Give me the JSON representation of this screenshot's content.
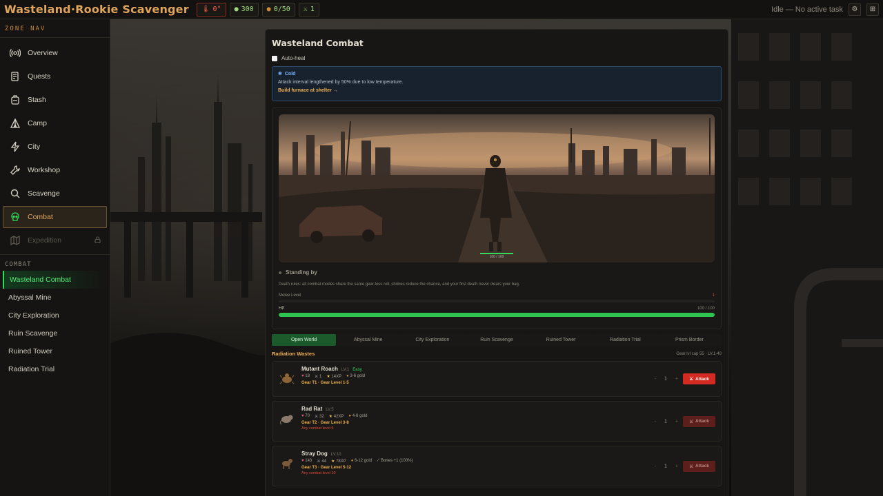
{
  "header": {
    "title": "Wasteland·Rookie Scavenger",
    "chips": [
      {
        "icon": "thermometer-icon",
        "value": "0°",
        "color": "#ff5a48"
      },
      {
        "icon": "coin-icon",
        "value": "300",
        "color": "#9fdc7f"
      },
      {
        "icon": "bag-icon",
        "value": "0/50",
        "color": "#9fdc7f"
      },
      {
        "icon": "swords-icon",
        "value": "1",
        "color": "#9fdc7f"
      }
    ],
    "status": "Idle — No active task",
    "settings_icon": "gear-icon",
    "panel_icon": "layout-icon"
  },
  "sidebar": {
    "heading": "ZONE NAV",
    "items": [
      {
        "label": "Overview",
        "icon": "radio-icon"
      },
      {
        "label": "Quests",
        "icon": "scroll-icon"
      },
      {
        "label": "Stash",
        "icon": "backpack-icon"
      },
      {
        "label": "Camp",
        "icon": "tent-icon"
      },
      {
        "label": "City",
        "icon": "bolt-icon"
      },
      {
        "label": "Workshop",
        "icon": "wrench-icon"
      },
      {
        "label": "Scavenge",
        "icon": "search-icon"
      },
      {
        "label": "Combat",
        "icon": "skull-icon"
      },
      {
        "label": "Expedition",
        "icon": "map-icon"
      }
    ],
    "sub_heading": "COMBAT",
    "sub_items": [
      "Wasteland Combat",
      "Abyssal Mine",
      "City Exploration",
      "Ruin Scavenge",
      "Ruined Tower",
      "Radiation Trial"
    ]
  },
  "main": {
    "title": "Wasteland Combat",
    "autoheal_label": "Auto-heal",
    "notice": {
      "title": "Cold",
      "body": "Attack interval lengthened by 50% due to low temperature.",
      "link": "Build furnace at shelter →"
    },
    "scene_hp": "100 / 100",
    "status": "Standing by",
    "rules": "Death rules: all combat modes share the same gear-loss roll, shrines reduce the chance, and your first death never clears your bag.",
    "melee_label": "Melee Level",
    "melee_value": "1",
    "hp_label": "HP",
    "hp_value": "100 / 100",
    "hp_fraction": 1.0,
    "tabs": [
      "Open World",
      "Abyssal Mine",
      "City Exploration",
      "Ruin Scavenge",
      "Ruined Tower",
      "Radiation Trial",
      "Prism Border"
    ],
    "zone_title": "Radiation Wastes",
    "zone_meta": "Gear lvl cap 55 · LV.1-40",
    "enemies": [
      {
        "name": "Mutant Roach",
        "level": "LV.1",
        "difficulty": "Easy",
        "hp": "18",
        "atk": "1",
        "xp": "14XP",
        "gold": "3-6 gold",
        "extra": "",
        "gear": "Gear T1 · Gear Level 1-5",
        "requirement": "",
        "qty": "1",
        "attack_label": "Attack"
      },
      {
        "name": "Rad Rat",
        "level": "LV.5",
        "difficulty": "",
        "hp": "70",
        "atk": "32",
        "xp": "42XP",
        "gold": "4-8 gold",
        "extra": "",
        "gear": "Gear T2 · Gear Level 3-8",
        "requirement": "Any combat level 5",
        "qty": "1",
        "attack_label": "Attack"
      },
      {
        "name": "Stray Dog",
        "level": "LV.10",
        "difficulty": "",
        "hp": "143",
        "atk": "44",
        "xp": "78XP",
        "gold": "6-12 gold",
        "extra": "Bones +1 (100%)",
        "gear": "Gear T3 · Gear Level 5-12",
        "requirement": "Any combat level 10",
        "qty": "1",
        "attack_label": "Attack"
      }
    ],
    "decrement_symbol": "-",
    "increment_symbol": "+"
  }
}
